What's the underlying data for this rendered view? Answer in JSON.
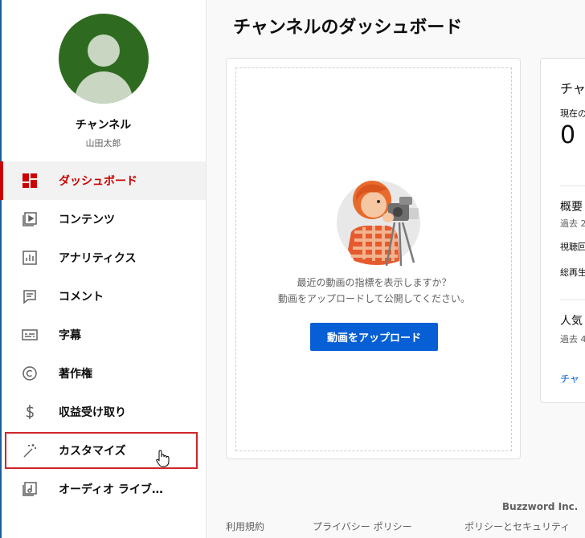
{
  "page_title": "チャンネルのダッシュボード",
  "channel": {
    "name": "チャンネル",
    "owner": "山田太郎"
  },
  "nav": [
    {
      "label": "ダッシュボード",
      "icon": "dashboard-icon"
    },
    {
      "label": "コンテンツ",
      "icon": "content-icon"
    },
    {
      "label": "アナリティクス",
      "icon": "analytics-icon"
    },
    {
      "label": "コメント",
      "icon": "comment-icon"
    },
    {
      "label": "字幕",
      "icon": "subtitles-icon"
    },
    {
      "label": "著作権",
      "icon": "copyright-icon"
    },
    {
      "label": "収益受け取り",
      "icon": "dollar-icon"
    },
    {
      "label": "カスタマイズ",
      "icon": "magic-wand-icon"
    },
    {
      "label": "オーディオ ライブ…",
      "icon": "audio-library-icon"
    }
  ],
  "upload_card": {
    "prompt_line1": "最近の動画の指標を表示しますか？",
    "prompt_line2": "動画をアップロードして公開してください。",
    "button_label": "動画をアップロード"
  },
  "analytics_card": {
    "title": "チャ",
    "subscribers_label": "現在の",
    "subscribers_value": "0",
    "summary_title": "概要",
    "summary_period": "過去 2",
    "views_label": "視聴回",
    "watch_time_label": "総再生",
    "popular_title": "人気",
    "popular_period": "過去 4",
    "link": "チャ"
  },
  "footer": {
    "brand": "Buzzword Inc.",
    "links": [
      "利用規約",
      "プライバシー ポリシー",
      "ポリシーとセキュリティ"
    ]
  },
  "colors": {
    "accent_red": "#cc0000",
    "primary_blue": "#065fd4",
    "avatar_green": "#2e6b20"
  }
}
